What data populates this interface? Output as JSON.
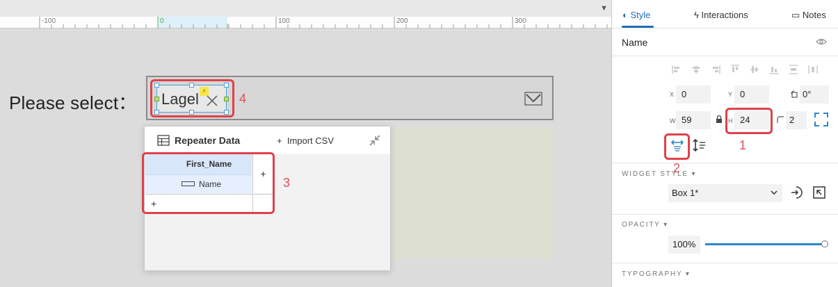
{
  "canvas": {
    "ruler": {
      "labels": [
        "-100",
        "0",
        "100",
        "200",
        "300"
      ]
    },
    "please_select_label": "Please select：",
    "dropdown": {
      "selected_text": "Lagel",
      "arrow_icon": "chevron-down-icon"
    },
    "callouts": {
      "one": "1",
      "two": "2",
      "three": "3",
      "four": "4"
    },
    "repeater": {
      "title": "Repeater Data",
      "import_label": "Import CSV",
      "import_plus": "+",
      "column_header": "First_Name",
      "cell_value": "Name",
      "add_column": "+",
      "add_row": "+"
    }
  },
  "panel": {
    "tabs": {
      "style": "Style",
      "interactions": "Interactions",
      "notes": "Notes"
    },
    "name_label": "Name",
    "fields": {
      "x_label": "X",
      "x_value": "0",
      "y_label": "Y",
      "y_value": "0",
      "rotation_value": "0°",
      "w_label": "W",
      "w_value": "59",
      "h_label": "H",
      "h_value": "24",
      "radius_value": "2"
    },
    "widget_style": {
      "title": "WIDGET STYLE ▾",
      "selected": "Box 1*"
    },
    "opacity": {
      "title": "OPACITY ▾",
      "value": "100%",
      "level": 1.0
    },
    "typography": {
      "title": "TYPOGRAPHY ▾"
    }
  },
  "colors": {
    "accent_blue": "#1f6fb7",
    "callout_red": "#e0404a",
    "selection_blue": "#4d9fd6"
  }
}
